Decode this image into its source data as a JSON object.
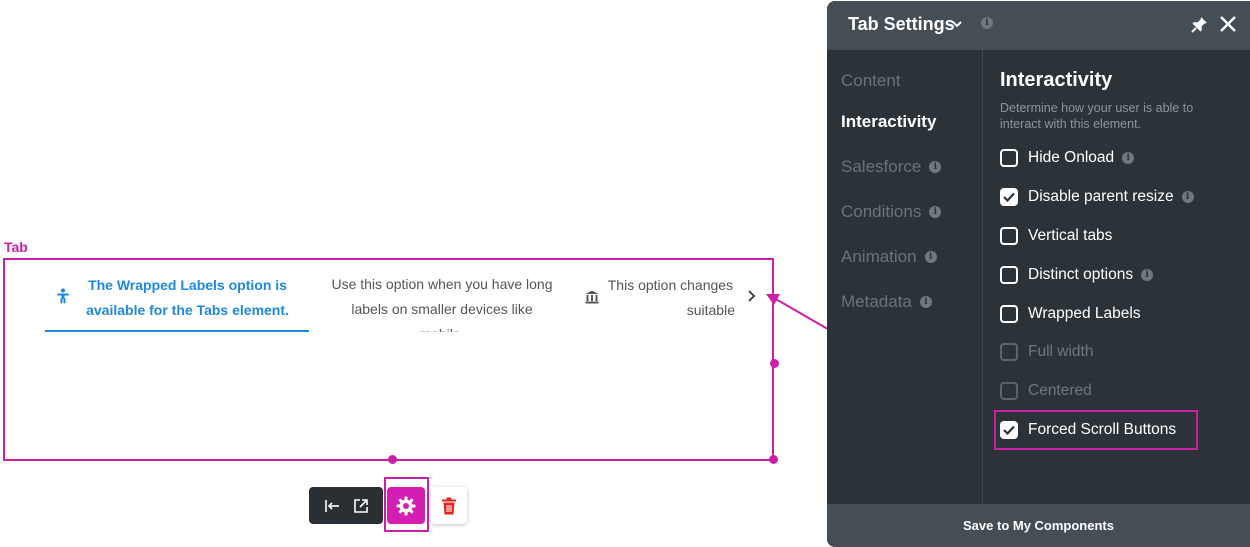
{
  "canvas": {
    "element_tag": "Tab",
    "tabs": [
      {
        "label": "The Wrapped Labels option is available for the Tabs element.",
        "icon": "accessibility-icon",
        "active": true
      },
      {
        "label": "Use this option when you have long labels on smaller devices like mobile.",
        "icon": "",
        "active": false
      },
      {
        "label": "This option changes the tab labels to fit a suitable device.",
        "icon": "bank-icon",
        "active": false
      }
    ],
    "scroll_button": "chevron-right-icon"
  },
  "toolbar": {
    "buttons": [
      "align-left-icon",
      "open-external-icon",
      "gear-icon",
      "trash-icon"
    ]
  },
  "panel": {
    "title": "Tab Settings",
    "nav": [
      {
        "label": "Content",
        "active": false,
        "info": false
      },
      {
        "label": "Interactivity",
        "active": true,
        "info": false
      },
      {
        "label": "Salesforce",
        "active": false,
        "info": true
      },
      {
        "label": "Conditions",
        "active": false,
        "info": true
      },
      {
        "label": "Animation",
        "active": false,
        "info": true
      },
      {
        "label": "Metadata",
        "active": false,
        "info": true
      }
    ],
    "section_title": "Interactivity",
    "section_desc": "Determine how your user is able to interact with this element.",
    "options": [
      {
        "label": "Hide Onload",
        "checked": false,
        "disabled": false,
        "info": true
      },
      {
        "label": "Disable parent resize",
        "checked": true,
        "disabled": false,
        "info": true
      },
      {
        "label": "Vertical tabs",
        "checked": false,
        "disabled": false,
        "info": false
      },
      {
        "label": "Distinct options",
        "checked": false,
        "disabled": false,
        "info": true
      },
      {
        "label": "Wrapped Labels",
        "checked": false,
        "disabled": false,
        "info": false
      },
      {
        "label": "Full width",
        "checked": false,
        "disabled": true,
        "info": false
      },
      {
        "label": "Centered",
        "checked": false,
        "disabled": true,
        "info": false
      },
      {
        "label": "Forced Scroll Buttons",
        "checked": true,
        "disabled": false,
        "info": false
      }
    ],
    "footer": "Save to My Components",
    "info_glyph": "i"
  },
  "colors": {
    "highlight": "#cc1fa8",
    "active_tab": "#1e88e5",
    "panel_bg": "#2c3338",
    "panel_header": "#454e55"
  }
}
